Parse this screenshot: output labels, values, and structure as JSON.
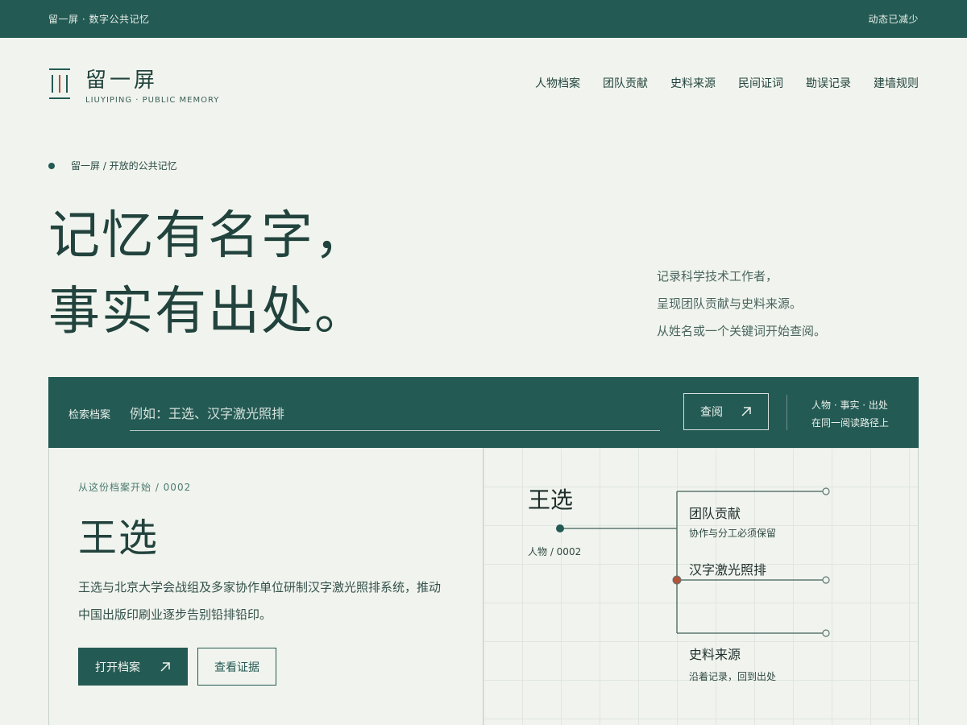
{
  "topbar": {
    "left": "留一屏 · 数字公共记忆",
    "right": "动态已减少"
  },
  "brand": {
    "name": "留一屏",
    "sub": "LIUYIPING · PUBLIC MEMORY",
    "accent": "#b4523a"
  },
  "nav": [
    "人物档案",
    "团队贡献",
    "史料来源",
    "民间证词",
    "勘误记录",
    "建墙规则"
  ],
  "breadcrumb": "留一屏 / 开放的公共记忆",
  "hero": {
    "line1": "记忆有名字，",
    "line2": "事实有出处。"
  },
  "intro": [
    "记录科学技术工作者，",
    "呈现团队贡献与史料来源。",
    "从姓名或一个关键词开始查阅。"
  ],
  "search": {
    "label": "检索档案",
    "placeholder": "例如：王选、汉字激光照排",
    "button": "查阅",
    "note1": "人物 · 事实 · 出处",
    "note2": "在同一阅读路径上"
  },
  "card": {
    "eyebrow": "从这份档案开始 / 0002",
    "name": "王选",
    "description": "王选与北京大学会战组及多家协作单位研制汉字激光照排系统，推动中国出版印刷业逐步告别铅排铅印。",
    "open_button": "打开档案",
    "evidence_button": "查看证据"
  },
  "graph": {
    "name": "王选",
    "id": "人物 / 0002",
    "branch1_title": "团队贡献",
    "branch1_sub": "协作与分工必须保留",
    "branch2_title": "汉字激光照排",
    "branch3_title": "史料来源",
    "branch3_sub": "沿着记录，回到出处"
  },
  "colors": {
    "primary": "#245a54",
    "background": "#f1f4ee",
    "accent": "#b4523a"
  }
}
